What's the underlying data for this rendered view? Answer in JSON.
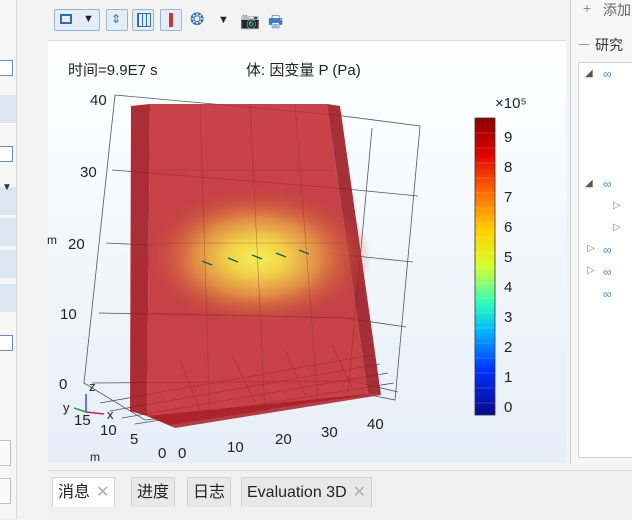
{
  "viewport": {
    "time_label": "时间=9.9E7 s",
    "expression_label": "体: 因变量 P (Pa)"
  },
  "colorbar": {
    "multiplier": "×10⁵",
    "ticks": [
      "9",
      "8",
      "7",
      "6",
      "5",
      "4",
      "3",
      "2",
      "1",
      "0"
    ]
  },
  "axes": {
    "z_ticks": [
      "40",
      "30",
      "20",
      "10",
      "0"
    ],
    "x_ticks": [
      "0",
      "10",
      "20",
      "30",
      "40"
    ],
    "y_ticks": [
      "15",
      "10",
      "5",
      "0"
    ],
    "z_unit": "m",
    "y_unit": "m",
    "triad": {
      "z": "z",
      "y": "y",
      "x": "x"
    }
  },
  "right_panel": {
    "add_label": "添加",
    "study_label": "研究"
  },
  "tabs": [
    {
      "label": "消息",
      "closable": true,
      "active": true
    },
    {
      "label": "进度",
      "closable": false,
      "active": false
    },
    {
      "label": "日志",
      "closable": false,
      "active": false
    },
    {
      "label": "Evaluation 3D",
      "closable": true,
      "active": false
    }
  ],
  "colors": {
    "block_red": "#b8202a",
    "hot_yellow": "#f2e23a",
    "accent_blue": "#2f6fb0"
  }
}
